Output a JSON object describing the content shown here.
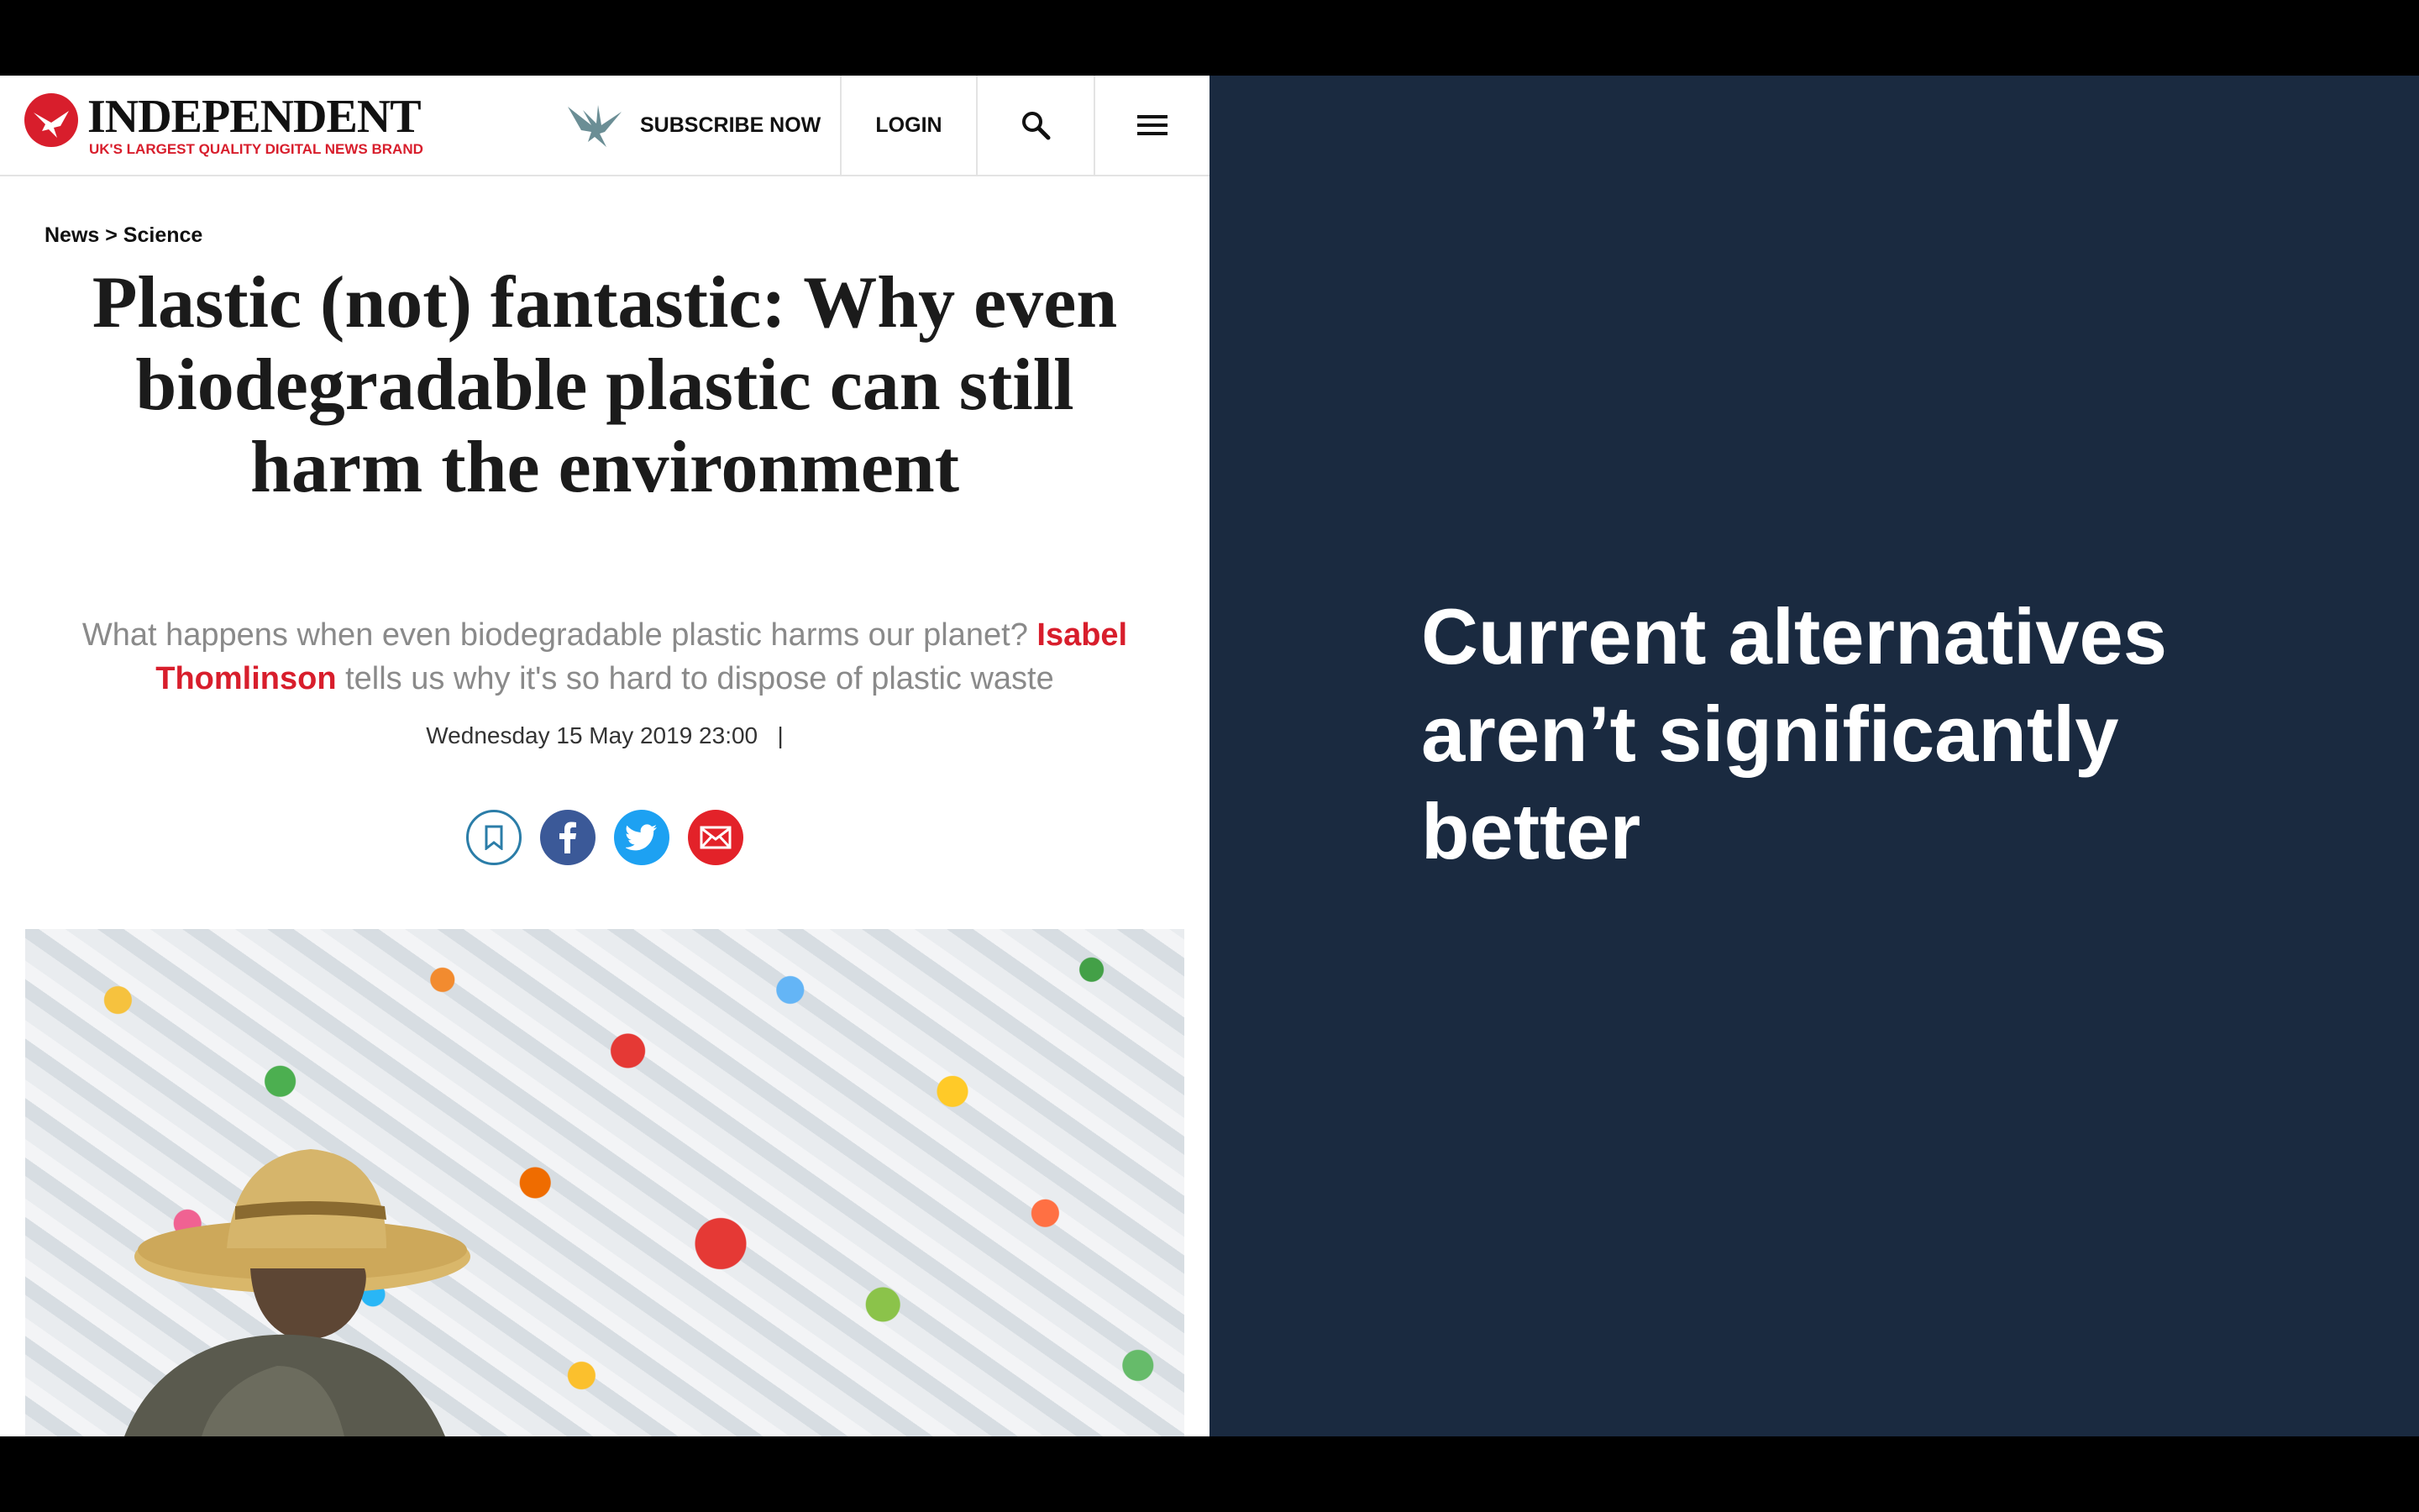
{
  "site": {
    "name": "INDEPENDENT",
    "tagline": "UK'S LARGEST QUALITY DIGITAL NEWS BRAND",
    "logo_icon": "eagle-logo-icon",
    "brand_color": "#d81e2c"
  },
  "nav": {
    "subscribe_label": "SUBSCRIBE NOW",
    "login_label": "LOGIN",
    "search_icon": "search-icon",
    "menu_icon": "hamburger-menu-icon"
  },
  "article": {
    "breadcrumb": "News > Science",
    "headline": "Plastic (not) fantastic: Why even biodegradable plastic can still harm the environment",
    "standfirst_before": "What happens when even biodegradable plastic harms our planet? ",
    "author": "Isabel Thomlinson",
    "standfirst_after": " tells us why it's so hard to dispose of plastic waste",
    "date": "Wednesday 15 May 2019 23:00",
    "date_separator": "|",
    "share_buttons": [
      {
        "name": "bookmark",
        "icon": "bookmark-icon",
        "color": "#2b7da8"
      },
      {
        "name": "facebook",
        "icon": "facebook-icon",
        "color": "#3b5998"
      },
      {
        "name": "twitter",
        "icon": "twitter-icon",
        "color": "#1da1f2"
      },
      {
        "name": "email",
        "icon": "email-icon",
        "color": "#e32229"
      }
    ]
  },
  "slide": {
    "background_color": "#1a2a40",
    "text_line_1": "Current alternatives",
    "text_line_2": "aren’t significantly",
    "text_line_3": "better"
  }
}
